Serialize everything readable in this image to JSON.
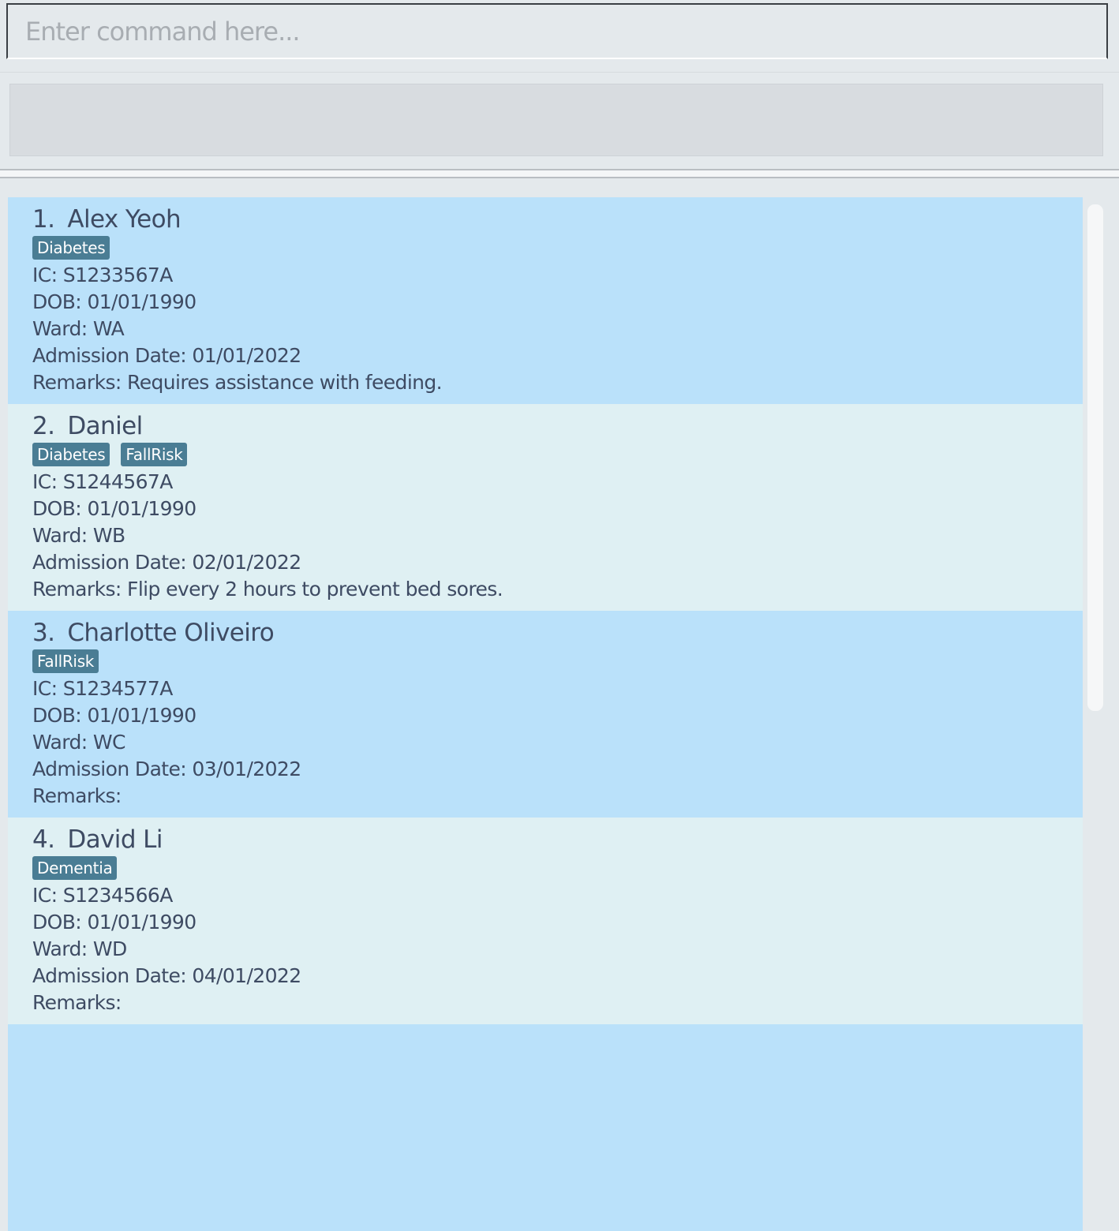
{
  "command": {
    "placeholder": "Enter command here...",
    "value": ""
  },
  "result": {
    "text": ""
  },
  "patients": [
    {
      "index": "1.",
      "name": "Alex Yeoh",
      "tags": [
        "Diabetes"
      ],
      "ic": "IC: S1233567A",
      "dob": "DOB: 01/01/1990",
      "ward": "Ward: WA",
      "admission": "Admission Date: 01/01/2022",
      "remarks": "Remarks: Requires assistance with feeding."
    },
    {
      "index": "2.",
      "name": "Daniel",
      "tags": [
        "Diabetes",
        "FallRisk"
      ],
      "ic": "IC: S1244567A",
      "dob": "DOB: 01/01/1990",
      "ward": "Ward: WB",
      "admission": "Admission Date: 02/01/2022",
      "remarks": "Remarks: Flip every 2 hours to prevent bed sores."
    },
    {
      "index": "3.",
      "name": "Charlotte Oliveiro",
      "tags": [
        "FallRisk"
      ],
      "ic": "IC: S1234577A",
      "dob": "DOB: 01/01/1990",
      "ward": "Ward: WC",
      "admission": "Admission Date: 03/01/2022",
      "remarks": "Remarks:"
    },
    {
      "index": "4.",
      "name": "David Li",
      "tags": [
        "Dementia"
      ],
      "ic": "IC: S1234566A",
      "dob": "DOB: 01/01/1990",
      "ward": "Ward: WD",
      "admission": "Admission Date: 04/01/2022",
      "remarks": "Remarks:"
    },
    {
      "index": "",
      "name": "",
      "tags": [],
      "ic": "",
      "dob": "",
      "ward": "",
      "admission": "",
      "remarks": ""
    }
  ],
  "colors": {
    "card_selected": "#bae1fa",
    "card_alternate": "#dff0f3",
    "tag_background": "#4a7d94",
    "text": "#3e4b63"
  }
}
